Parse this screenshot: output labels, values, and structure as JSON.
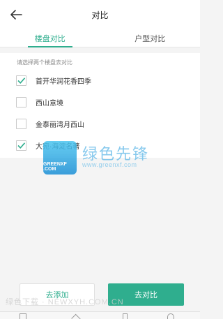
{
  "header": {
    "title": "对比"
  },
  "tabs": [
    {
      "label": "楼盘对比",
      "active": true
    },
    {
      "label": "户型对比",
      "active": false
    }
  ],
  "hint": "请选择两个楼盘去对比",
  "items": [
    {
      "label": "首开华润花香四季",
      "checked": true
    },
    {
      "label": "西山意境",
      "checked": false
    },
    {
      "label": "金泰丽湾月西山",
      "checked": false
    },
    {
      "label": "大宛·海淀名著",
      "checked": true
    }
  ],
  "buttons": {
    "add": "去添加",
    "compare": "去对比"
  },
  "watermark": {
    "logo_text": "GREENXF .COM",
    "main": "绿色先锋",
    "sub": "www.greenxf.com",
    "bottom": "绿色下载 · NEWXYH.COM.CN"
  },
  "colors": {
    "accent": "#2fae8e"
  }
}
